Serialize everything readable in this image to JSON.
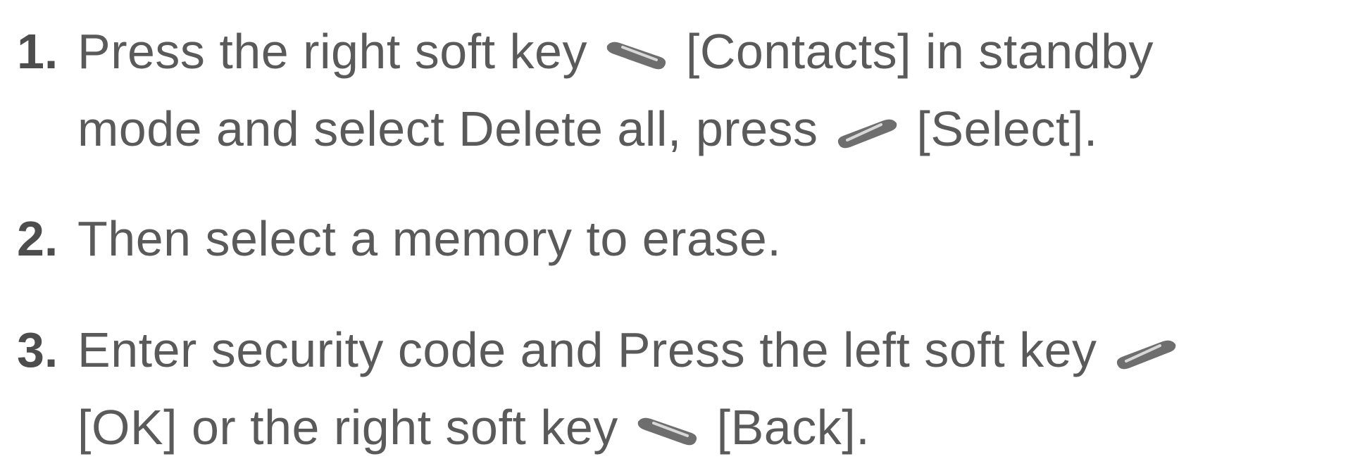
{
  "steps": [
    {
      "number": "1.",
      "line1": {
        "a": "Press the right soft key",
        "key": "right-soft-key-icon",
        "b": "[Contacts] in standby"
      },
      "line2": {
        "a": "mode and select Delete all, press",
        "key": "left-soft-key-icon",
        "b": "[Select]."
      }
    },
    {
      "number": "2.",
      "line1": {
        "a": "Then select a memory to erase."
      }
    },
    {
      "number": "3.",
      "line1": {
        "a": "Enter security code and Press the left soft key",
        "key": "left-soft-key-icon"
      },
      "line2": {
        "a": "[OK] or the right soft key",
        "key": "right-soft-key-icon",
        "b": "[Back]."
      }
    }
  ],
  "colors": {
    "text": "#5a5a5a",
    "icon": "#6e6e6e"
  }
}
